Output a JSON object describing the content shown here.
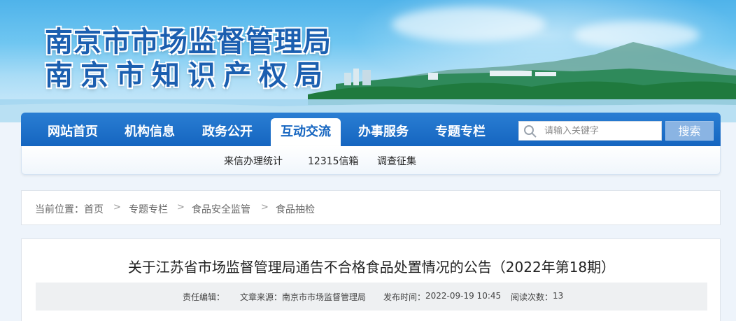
{
  "header": {
    "title_line1": "南京市市场监督管理局",
    "title_line2": "南京市知识产权局"
  },
  "nav": {
    "items": [
      {
        "label": "网站首页"
      },
      {
        "label": "机构信息"
      },
      {
        "label": "政务公开"
      },
      {
        "label": "互动交流",
        "active": true
      },
      {
        "label": "办事服务"
      },
      {
        "label": "专题专栏"
      }
    ],
    "search_placeholder": "请输入关键字",
    "search_button": "搜索"
  },
  "subnav": {
    "items": [
      {
        "label": "来信办理统计"
      },
      {
        "label": "12315信箱"
      },
      {
        "label": "调查征集"
      }
    ]
  },
  "breadcrumb": {
    "prefix": "当前位置：",
    "items": [
      "首页",
      "专题专栏",
      "食品安全监管",
      "食品抽检"
    ],
    "separator": ">"
  },
  "article": {
    "title": "关于江苏省市场监督管理局通告不合格食品处置情况的公告（2022年第18期）",
    "meta": {
      "editor_label": "责任编辑：",
      "editor_value": "",
      "source_label": "文章来源：",
      "source_value": "南京市市场监督管理局",
      "date_label": "发布时间：",
      "date_value": "2022-09-19 10:45",
      "views_label": "阅读次数：",
      "views_value": "13"
    }
  },
  "colors": {
    "nav_blue": "#1565c0",
    "title_blue": "#1b5fb0",
    "search_button": "#8ab4e3"
  }
}
